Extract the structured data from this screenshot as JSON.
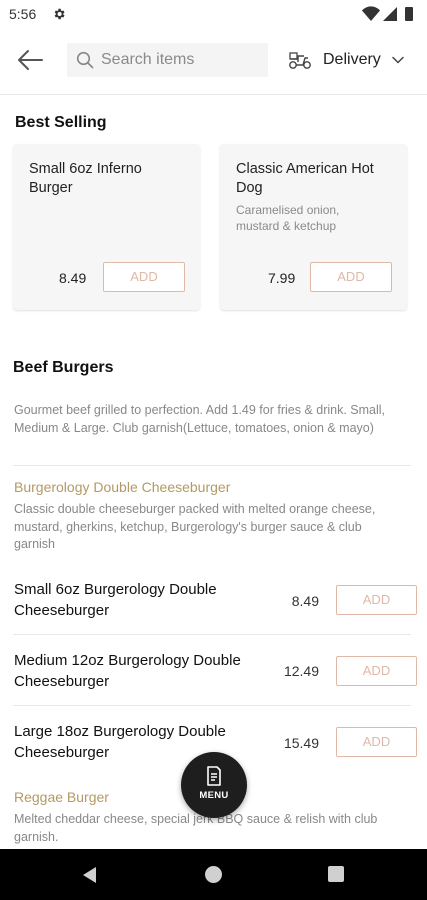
{
  "status_bar": {
    "time": "5:56",
    "icons": [
      "settings-gear-icon",
      "wifi-icon",
      "signal-icon",
      "battery-icon"
    ]
  },
  "header": {
    "back_icon": "arrow-left-icon",
    "search": {
      "placeholder": "Search items",
      "value": ""
    },
    "delivery": {
      "label": "Delivery",
      "icon": "scooter-icon",
      "chevron": "chevron-down-icon"
    }
  },
  "best_selling": {
    "title": "Best Selling",
    "cards": [
      {
        "name": "Small 6oz Inferno Burger",
        "desc": "",
        "price": "8.49",
        "add_label": "ADD"
      },
      {
        "name": "Classic American Hot Dog",
        "desc": "Caramelised onion, mustard & ketchup",
        "price": "7.99",
        "add_label": "ADD"
      }
    ]
  },
  "beef_burgers": {
    "title": "Beef Burgers",
    "description": "Gourmet beef grilled to perfection. Add 1.49 for fries & drink. Small, Medium & Large. Club garnish(Lettuce, tomatoes, onion & mayo)",
    "groups": [
      {
        "title": "Burgerology Double Cheeseburger",
        "desc": "Classic double cheeseburger packed with melted orange cheese, mustard, gherkins, ketchup, Burgerology's burger sauce & club garnish",
        "items": [
          {
            "name": "Small 6oz Burgerology Double Cheeseburger",
            "price": "8.49",
            "add_label": "ADD"
          },
          {
            "name": "Medium 12oz Burgerology Double Cheeseburger",
            "price": "12.49",
            "add_label": "ADD"
          },
          {
            "name": "Large 18oz Burgerology Double Cheeseburger",
            "price": "15.49",
            "add_label": "ADD"
          }
        ]
      },
      {
        "title": "Reggae Burger",
        "desc": "Melted cheddar cheese, special jerk BBQ sauce & relish with club garnish."
      }
    ]
  },
  "menu_fab": {
    "label": "MENU",
    "icon": "menu-document-icon"
  },
  "colors": {
    "accent": "#b39a63",
    "add_border": "#e0b8a8",
    "fab": "#1e1e1e",
    "nav": "#000000"
  }
}
